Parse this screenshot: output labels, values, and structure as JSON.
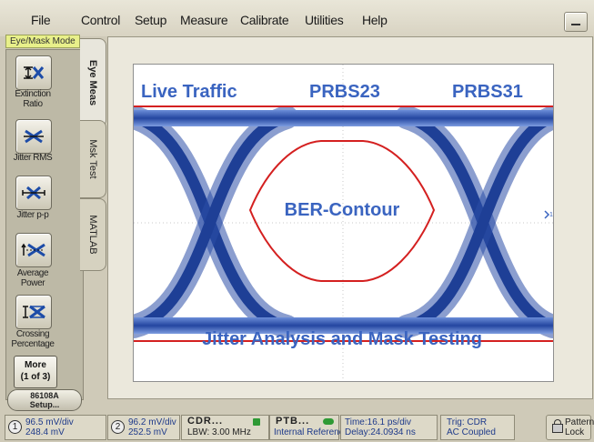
{
  "menu": {
    "items": [
      "File",
      "Control",
      "Setup",
      "Measure",
      "Calibrate",
      "Utilities",
      "Help"
    ]
  },
  "mode_label": "Eye/Mask Mode",
  "sidebar": {
    "measurements": [
      {
        "label": "Extinction Ratio",
        "icon": "extinction-ratio-icon"
      },
      {
        "label": "Jitter RMS",
        "icon": "jitter-rms-icon"
      },
      {
        "label": "Jitter p-p",
        "icon": "jitter-pp-icon"
      },
      {
        "label": "Average Power",
        "icon": "average-power-icon"
      },
      {
        "label": "Crossing Percentage",
        "icon": "crossing-percentage-icon"
      }
    ],
    "more_line1": "More",
    "more_line2": "(1 of 3)",
    "setup_line1": "86108A",
    "setup_line2": "Setup..."
  },
  "tabs": [
    "Eye Meas",
    "Msk Test",
    "MATLAB"
  ],
  "display": {
    "top_left": "Live Traffic",
    "top_mid": "PRBS23",
    "top_right": "PRBS31",
    "center": "BER-Contour",
    "bottom": "Jitter Analysis and Mask Testing",
    "marker": "1"
  },
  "statusbar": {
    "ch1": {
      "num": "1",
      "scale": "96.5 mV/div",
      "offset": "248.4 mV"
    },
    "ch2": {
      "num": "2",
      "scale": "96.2 mV/div",
      "offset": "252.5 mV"
    },
    "cdr": {
      "title": "CDR...",
      "detail": "LBW: 3.00 MHz"
    },
    "ptb": {
      "title": "PTB...",
      "detail": "Internal Reference"
    },
    "time": {
      "line1": "Time:16.1 ps/div",
      "line2": "Delay:24.0934 ns"
    },
    "trig": {
      "line1": "Trig: CDR",
      "line2": "AC Coupled"
    },
    "pattern_lock": {
      "line1": "Pattern",
      "line2": "Lock"
    }
  },
  "colors": {
    "eye_blue": "#2b4fa8",
    "contour_red": "#d42020",
    "label_blue": "#3a64c0",
    "lock_green": "#2f9a35"
  }
}
